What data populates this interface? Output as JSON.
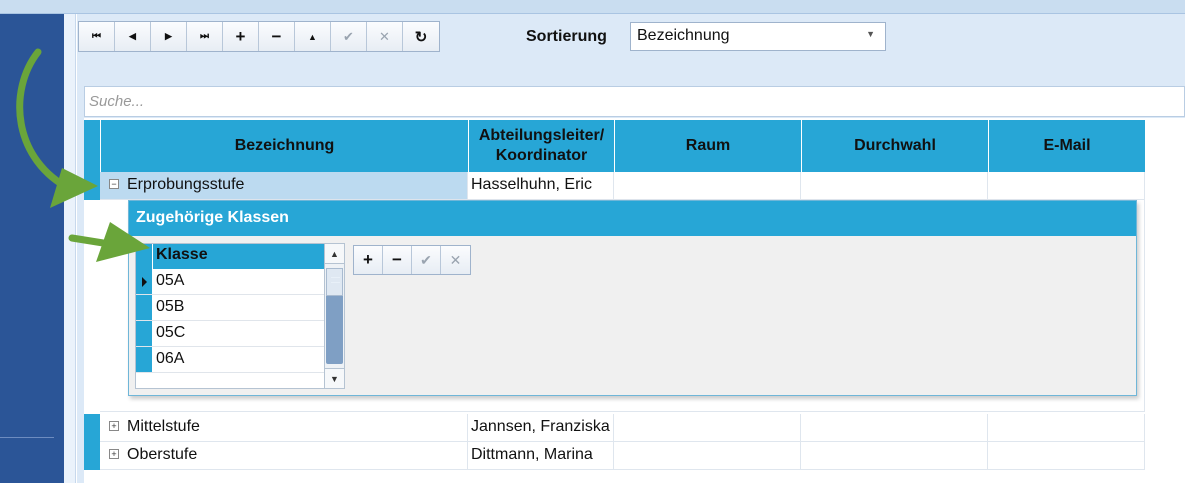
{
  "toolbar": {
    "buttons": [
      {
        "icon": "first-record-icon",
        "glyph": "⏮"
      },
      {
        "icon": "previous-record-icon",
        "glyph": "◀"
      },
      {
        "icon": "next-record-icon",
        "glyph": "▶"
      },
      {
        "icon": "last-record-icon",
        "glyph": "⏭"
      },
      {
        "icon": "add-icon",
        "glyph": "+"
      },
      {
        "icon": "remove-icon",
        "glyph": "−"
      },
      {
        "icon": "move-up-icon",
        "glyph": "▲"
      },
      {
        "icon": "confirm-icon",
        "glyph": "✔"
      },
      {
        "icon": "cancel-icon",
        "glyph": "✕"
      },
      {
        "icon": "refresh-icon",
        "glyph": "↻"
      }
    ]
  },
  "sorting": {
    "label": "Sortierung",
    "selected": "Bezeichnung"
  },
  "search": {
    "placeholder": "Suche..."
  },
  "grid": {
    "columns": [
      "Bezeichnung",
      "Abteilungsleiter/\nKoordinator",
      "Raum",
      "Durchwahl",
      "E-Mail"
    ],
    "rows": [
      {
        "expander": "−",
        "bezeichnung": "Erprobungsstufe",
        "leiter": "Hasselhuhn, Eric",
        "raum": "",
        "durchwahl": "",
        "email": ""
      },
      {
        "expander": "+",
        "bezeichnung": "Mittelstufe",
        "leiter": "Jannsen, Franziska",
        "raum": "",
        "durchwahl": "",
        "email": ""
      },
      {
        "expander": "+",
        "bezeichnung": "Oberstufe",
        "leiter": "Dittmann, Marina",
        "raum": "",
        "durchwahl": "",
        "email": ""
      }
    ]
  },
  "detail": {
    "title": "Zugehörige Klassen",
    "column": "Klasse",
    "rows": [
      "05A",
      "05B",
      "05C",
      "06A"
    ],
    "toolbar": [
      {
        "icon": "add-icon",
        "glyph": "+"
      },
      {
        "icon": "remove-icon",
        "glyph": "−"
      },
      {
        "icon": "confirm-icon",
        "glyph": "✔"
      },
      {
        "icon": "cancel-icon",
        "glyph": "✕"
      }
    ]
  },
  "colors": {
    "accent": "#27a6d6",
    "sidebar": "#2b5597",
    "arrow": "#6aa53a"
  }
}
